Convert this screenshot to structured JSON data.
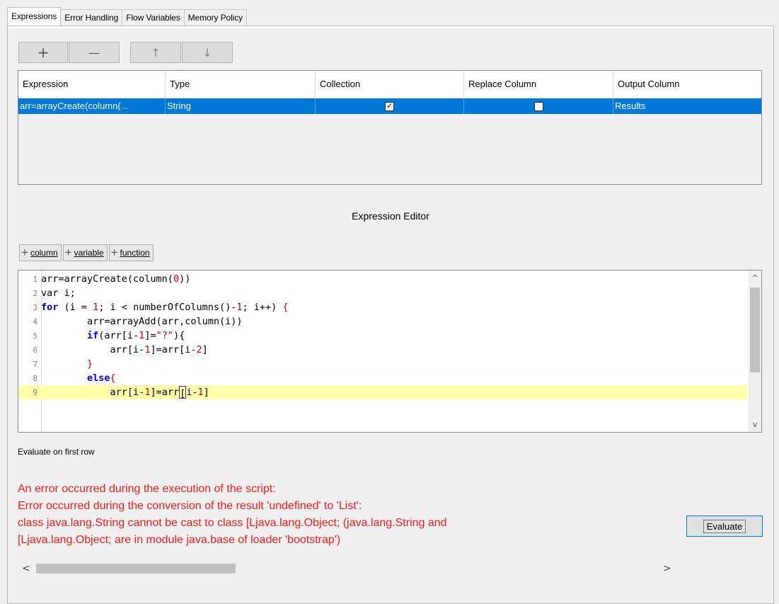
{
  "tabs": [
    {
      "label": "Expressions",
      "active": true
    },
    {
      "label": "Error Handling",
      "active": false
    },
    {
      "label": "Flow Variables",
      "active": false
    },
    {
      "label": "Memory Policy",
      "active": false
    }
  ],
  "toolbar": {
    "add_icon": "+",
    "remove_icon": "—",
    "up_icon": "↑",
    "down_icon": "↓"
  },
  "table": {
    "columns": [
      "Expression",
      "Type",
      "Collection",
      "Replace Column",
      "Output Column"
    ],
    "rows": [
      {
        "expression": "arr=arrayCreate(column(...",
        "type": "String",
        "collection": true,
        "replace_column": false,
        "output_column": "Results"
      }
    ]
  },
  "editor": {
    "title": "Expression Editor",
    "insert_buttons": [
      "column",
      "variable",
      "function"
    ],
    "lines": [
      {
        "n": "1",
        "text": "arr=arrayCreate(column(0))"
      },
      {
        "n": "2",
        "text": "var i;"
      },
      {
        "n": "3",
        "text": "for (i = 1; i < numberOfColumns()-1; i++) {"
      },
      {
        "n": "4",
        "text": "        arr=arrayAdd(arr,column(i))"
      },
      {
        "n": "5",
        "text": "        if(arr[i-1]=\"?\"){"
      },
      {
        "n": "6",
        "text": "            arr[i-1]=arr[i-2]"
      },
      {
        "n": "7",
        "text": "        }"
      },
      {
        "n": "8",
        "text": "        else{"
      },
      {
        "n": "9",
        "text": "            arr[i-1]=arr[i-1]"
      }
    ]
  },
  "evaluate": {
    "label": "Evaluate on first row",
    "button": "Evaluate",
    "error_lines": [
      "An error occurred during the execution of the script:",
      "Error occurred during the conversion of the result 'undefined' to 'List':",
      "class java.lang.String cannot be cast to class [Ljava.lang.Object; (java.lang.String and",
      "[Ljava.lang.Object; are in module java.base of loader 'bootstrap')"
    ]
  },
  "scroll": {
    "left_arrow": "<",
    "right_arrow": ">",
    "up_arrow": "^",
    "down_arrow": "v"
  }
}
